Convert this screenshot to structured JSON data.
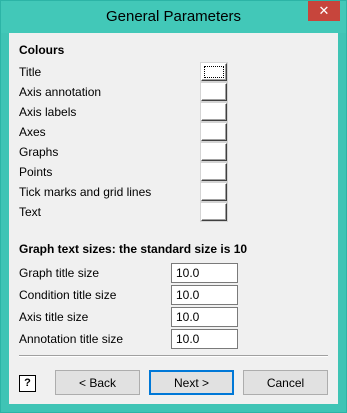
{
  "window": {
    "title": "General Parameters",
    "close_glyph": "✕"
  },
  "colours": {
    "heading": "Colours",
    "items": [
      {
        "label": "Title"
      },
      {
        "label": "Axis annotation"
      },
      {
        "label": "Axis labels"
      },
      {
        "label": "Axes"
      },
      {
        "label": "Graphs"
      },
      {
        "label": "Points"
      },
      {
        "label": "Tick marks and grid lines"
      },
      {
        "label": "Text"
      }
    ]
  },
  "text_sizes": {
    "heading": "Graph text sizes: the standard size is 10",
    "items": [
      {
        "label": "Graph title size",
        "value": "10.0"
      },
      {
        "label": "Condition title size",
        "value": "10.0"
      },
      {
        "label": "Axis title size",
        "value": "10.0"
      },
      {
        "label": "Annotation title size",
        "value": "10.0"
      }
    ]
  },
  "footer": {
    "help_glyph": "?",
    "back_label": "< Back",
    "next_label": "Next >",
    "cancel_label": "Cancel"
  }
}
